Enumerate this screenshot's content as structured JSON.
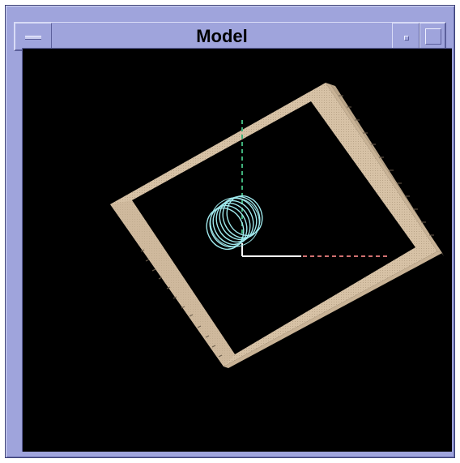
{
  "window": {
    "title": "Model",
    "menu_icon": "window-menu-icon",
    "minimize_icon": "minimize-icon",
    "maximize_icon": "maximize-icon"
  },
  "colors": {
    "frame": "#9fa4dc",
    "viewport_bg": "#000000",
    "plate": "#d7c2a6",
    "coil": "#9fe8ec",
    "axis_x": "#d07070",
    "axis_y": "#3fb07a",
    "axis_origin": "#ffffff"
  }
}
